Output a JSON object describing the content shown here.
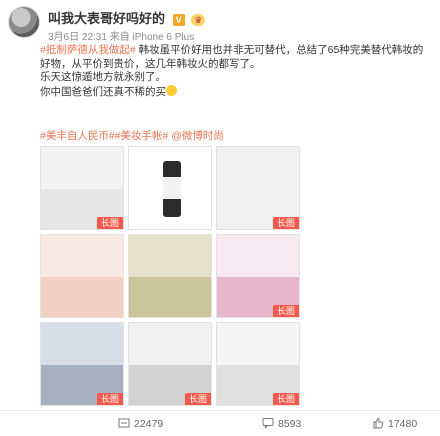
{
  "post": {
    "username": "叫我大表哥好吗好的",
    "badge_v": "V",
    "badge_crown": "♛",
    "time": "3月6日 22:31",
    "source_prefix": "来自",
    "source": "iPhone 6 Plus",
    "content_line1_tag": "#抵制萨德从我做起#",
    "content_line1": " 韩妆虽平价好用也并非无可替代，总结了65种完美替代韩妆的好物，从平价到贵价，这几年韩妆火的都写了。",
    "content_line2": "乐天这惊遁地方就永别了。",
    "content_line3": "你中国爸爸们还真不稀的买",
    "hashtags": "#美丰自人民币##美妆手帐# @微博时尚"
  },
  "images": {
    "long_label": "长图",
    "cells": [
      {
        "id": "img-1",
        "top_color": "#f3f3f3",
        "bottom_color": "#e6e6e6"
      },
      {
        "id": "img-2",
        "top_color": "#ffffff",
        "bottom_color": "#d9d9d9"
      },
      {
        "id": "img-3",
        "top_color": "#f0f0f0",
        "bottom_color": "#e8e8e8"
      },
      {
        "id": "img-4",
        "top_color": "#f7e9e2",
        "bottom_color": "#f2d0c3"
      },
      {
        "id": "img-5",
        "top_color": "#e3e1c9",
        "bottom_color": "#c9c49a"
      },
      {
        "id": "img-6",
        "top_color": "#f6e9ef",
        "bottom_color": "#e7b8cb"
      },
      {
        "id": "img-7",
        "top_color": "#d7dde6",
        "bottom_color": "#a7b0c0"
      },
      {
        "id": "img-8",
        "top_color": "#f0f0f0",
        "bottom_color": "#d2d2d2"
      },
      {
        "id": "img-9",
        "top_color": "#f5f5f5",
        "bottom_color": "#e0e0e0"
      }
    ]
  },
  "actions": {
    "repost_count": "22479",
    "comment_count": "8593",
    "like_count": "17480"
  }
}
